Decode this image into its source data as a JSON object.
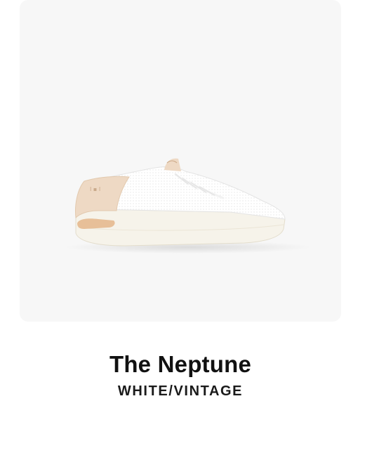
{
  "product": {
    "name": "The Neptune",
    "color": "WHITE/VINTAGE",
    "image_subject": "white-knit-sneaker-with-tan-heel",
    "colors": {
      "image_background": "#f7f7f7",
      "upper": "#ffffff",
      "heel_accent": "#eed9c4",
      "sole": "#f6f3ea",
      "text": "#111111"
    }
  }
}
